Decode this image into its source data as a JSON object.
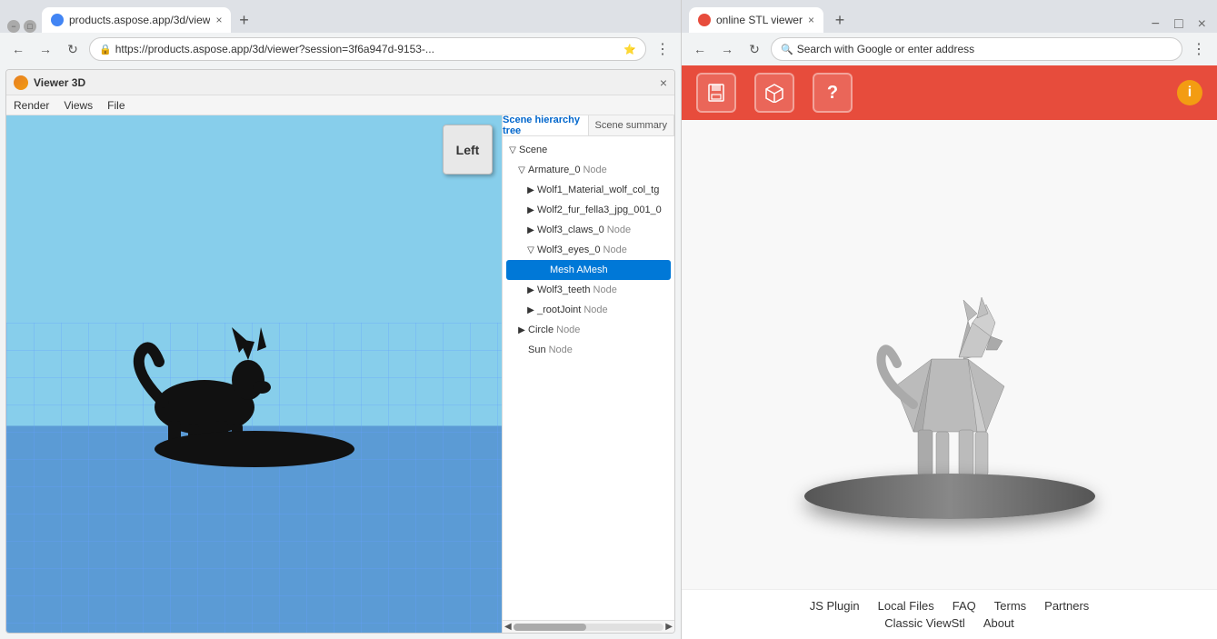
{
  "left_browser": {
    "tab_title": "products.aspose.app/3d/view",
    "address": "https://products.aspose.app/3d/viewer?session=3f6a947d-9153-...",
    "viewer_title": "Viewer 3D",
    "menu_items": [
      "Render",
      "Views",
      "File"
    ],
    "nav_cube_label": "Left",
    "scene_tabs": [
      "Scene hierarchy tree",
      "Scene summary"
    ],
    "scene_tree": [
      {
        "label": "Scene",
        "type": "",
        "depth": 0,
        "toggle": "▽",
        "indent": 0
      },
      {
        "label": "Armature_0",
        "type": "Node",
        "depth": 1,
        "toggle": "▽",
        "indent": 1
      },
      {
        "label": "Wolf1_Material_wolf_col_tg",
        "type": "",
        "depth": 2,
        "toggle": "▶",
        "indent": 2
      },
      {
        "label": "Wolf2_fur_fella3_jpg_001_0",
        "type": "",
        "depth": 2,
        "toggle": "▶",
        "indent": 2
      },
      {
        "label": "Wolf3_claws_0",
        "type": "Node",
        "depth": 2,
        "toggle": "▶",
        "indent": 2
      },
      {
        "label": "Wolf3_eyes_0",
        "type": "Node",
        "depth": 2,
        "toggle": "▽",
        "indent": 2
      },
      {
        "label": "Mesh AMesh",
        "type": "",
        "depth": 3,
        "toggle": "",
        "indent": 3,
        "selected": true
      },
      {
        "label": "Wolf3_teeth",
        "type": "Node",
        "depth": 2,
        "toggle": "▶",
        "indent": 2
      },
      {
        "label": "_rootJoint",
        "type": "Node",
        "depth": 2,
        "toggle": "▶",
        "indent": 2
      },
      {
        "label": "Circle",
        "type": "Node",
        "depth": 1,
        "toggle": "▶",
        "indent": 1
      },
      {
        "label": "Sun",
        "type": "Node",
        "depth": 1,
        "toggle": "",
        "indent": 1
      }
    ],
    "close_btn": "×",
    "new_tab_btn": "+"
  },
  "right_browser": {
    "tab_title": "online STL viewer",
    "address": "Search with Google or enter address",
    "window_controls": [
      "−",
      "□",
      "×"
    ],
    "toolbar_buttons": [
      "💾",
      "📦",
      "?"
    ],
    "footer_links_row1": [
      "JS Plugin",
      "Local Files",
      "FAQ",
      "Terms",
      "Partners"
    ],
    "footer_links_row2": [
      "Classic ViewStl",
      "About"
    ],
    "info_icon": "i"
  },
  "colors": {
    "aspose_orange": "#e67e22",
    "stl_red": "#e74c3c",
    "sky_blue": "#87ceeb",
    "grid_blue": "#5b9bd5",
    "selected_blue": "#0078d7"
  }
}
